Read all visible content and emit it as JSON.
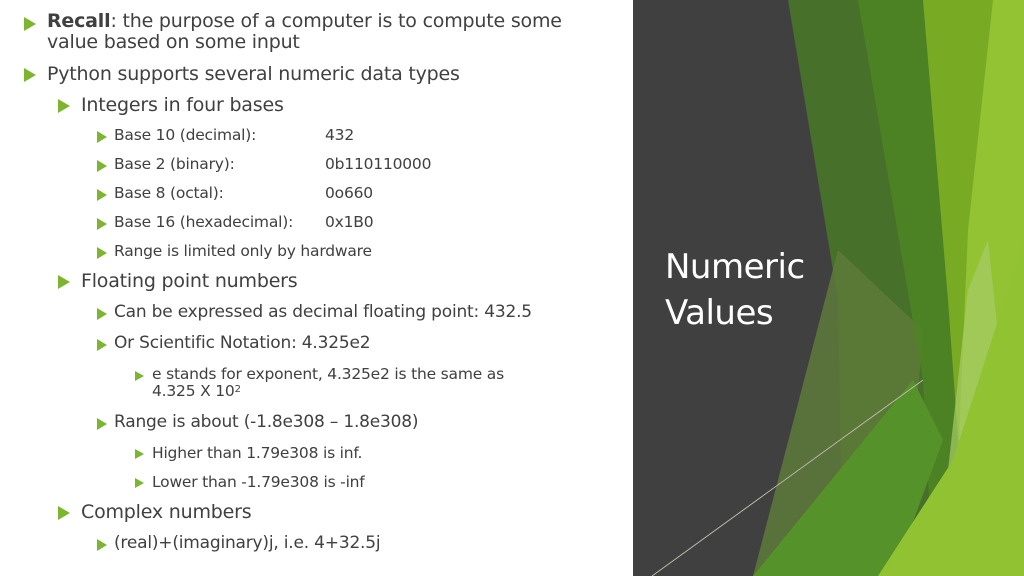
{
  "slide": {
    "title_line1": "Numeric",
    "title_line2": "Values",
    "accent_color": "#7cb62f",
    "panel_color": "#404040",
    "text_color": "#404040"
  },
  "bullets": {
    "recall_label": "Recall",
    "recall_line1": ":  the purpose of a computer is to compute some",
    "recall_line2": "value based on some input",
    "python_types": "Python supports several numeric data types",
    "integers": "Integers in four bases",
    "bases": [
      {
        "label": "Base 10 (decimal):",
        "value": "432"
      },
      {
        "label": "Base 2 (binary):",
        "value": "0b110110000"
      },
      {
        "label": "Base 8 (octal):",
        "value": "0o660"
      },
      {
        "label": "Base 16 (hexadecimal):",
        "value": "0x1B0"
      }
    ],
    "int_range": "Range is limited only by hardware",
    "floats": "Floating point numbers",
    "float_decimal": "Can be expressed as decimal floating point:  432.5",
    "float_sci": "Or Scientific Notation:  4.325e2",
    "exp_line1": "e stands for exponent, 4.325e2 is the same as",
    "exp_line2": "4.325 X 10",
    "exp_sup": "2",
    "float_range": "Range is about  (-1.8e308 – 1.8e308)",
    "higher": "Higher than 1.79e308 is inf.",
    "lower": "Lower than -1.79e308 is -inf",
    "complex": "Complex numbers",
    "complex_form": "(real)+(imaginary)j, i.e. 4+32.5j"
  }
}
